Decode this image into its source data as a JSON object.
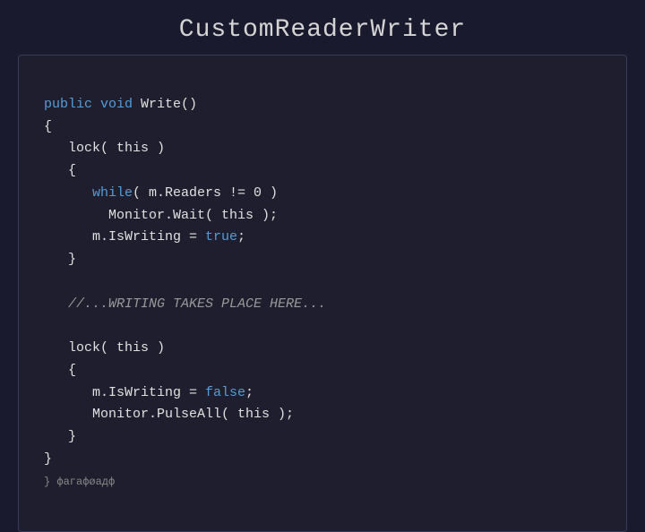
{
  "title": "CustomReaderWriter",
  "code": {
    "lines": [
      {
        "type": "normal",
        "text": "public void Write()"
      },
      {
        "type": "normal",
        "text": "{"
      },
      {
        "type": "normal",
        "text": "   lock( this )"
      },
      {
        "type": "normal",
        "text": "   {"
      },
      {
        "type": "normal",
        "text": "      while( m.Readers != 0 )"
      },
      {
        "type": "normal",
        "text": "        Monitor.Wait( this );"
      },
      {
        "type": "normal",
        "text": "      m.IsWriting = true;"
      },
      {
        "type": "normal",
        "text": "   }"
      },
      {
        "type": "blank",
        "text": ""
      },
      {
        "type": "comment",
        "text": "   //...WRITING TAKES PLACE HERE..."
      },
      {
        "type": "blank",
        "text": ""
      },
      {
        "type": "normal",
        "text": "   lock( this )"
      },
      {
        "type": "normal",
        "text": "   {"
      },
      {
        "type": "normal",
        "text": "      m.IsWriting = false;"
      },
      {
        "type": "normal",
        "text": "      Monitor.PulseAll( this );"
      },
      {
        "type": "normal",
        "text": "   }"
      },
      {
        "type": "normal",
        "text": "}"
      },
      {
        "type": "label",
        "text": "} фагафøадф"
      }
    ]
  }
}
